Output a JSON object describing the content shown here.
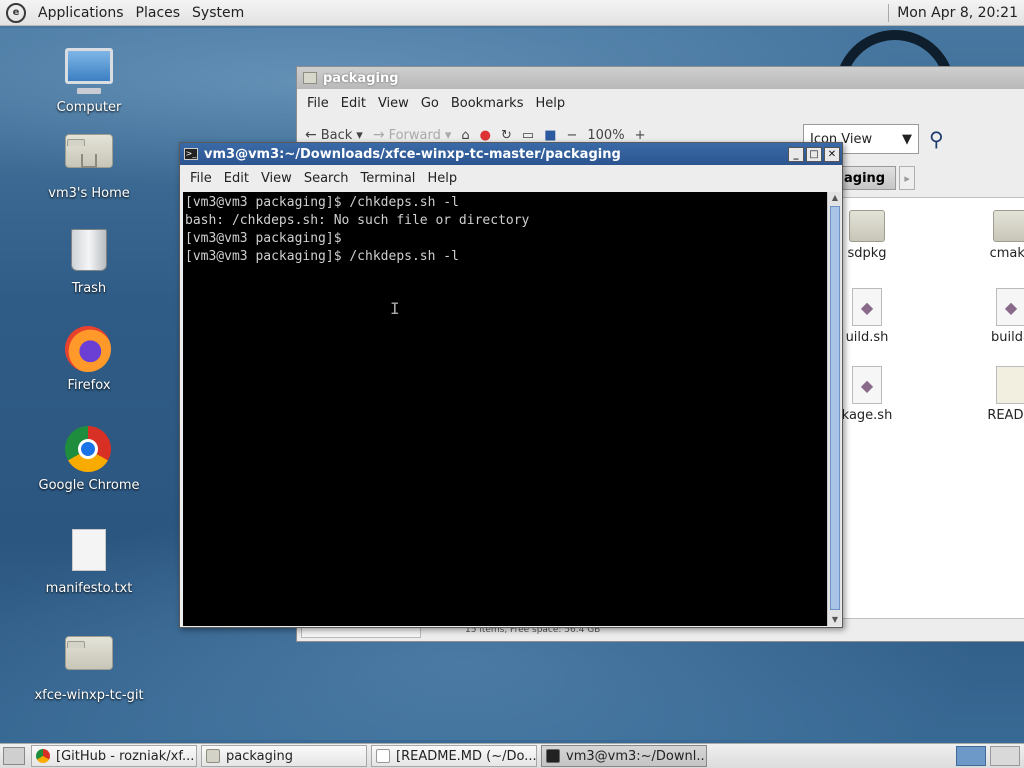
{
  "top_panel": {
    "menus": [
      "Applications",
      "Places",
      "System"
    ],
    "clock": "Mon Apr  8, 20:21"
  },
  "desktop_icons": [
    {
      "label": "Computer",
      "icon": "computer-icon"
    },
    {
      "label": "vm3's Home",
      "icon": "home-folder-icon"
    },
    {
      "label": "Trash",
      "icon": "trash-icon"
    },
    {
      "label": "Firefox",
      "icon": "firefox-icon"
    },
    {
      "label": "Google Chrome",
      "icon": "chrome-icon"
    },
    {
      "label": "manifesto.txt",
      "icon": "text-file-icon"
    },
    {
      "label": "xfce-winxp-tc-git",
      "icon": "folder-icon"
    }
  ],
  "file_manager": {
    "title": "packaging",
    "menus": [
      "File",
      "Edit",
      "View",
      "Go",
      "Bookmarks",
      "Help"
    ],
    "toolbar": {
      "back": "Back",
      "forward": "Forward",
      "zoom": "100%"
    },
    "view_select": "Icon View",
    "path_current": "aging",
    "files": [
      {
        "label": "sdpkg",
        "type": "folder"
      },
      {
        "label": "cmake",
        "type": "folder"
      },
      {
        "label": "uild.sh",
        "type": "script"
      },
      {
        "label": "builda",
        "type": "script"
      },
      {
        "label": "kage.sh",
        "type": "script"
      },
      {
        "label": "READM",
        "type": "readme"
      }
    ],
    "status": "15 items, Free space: 56.4 GB"
  },
  "terminal": {
    "title": "vm3@vm3:~/Downloads/xfce-winxp-tc-master/packaging",
    "menus": [
      "File",
      "Edit",
      "View",
      "Search",
      "Terminal",
      "Help"
    ],
    "lines": [
      "[vm3@vm3 packaging]$ /chkdeps.sh -l",
      "bash: /chkdeps.sh: No such file or directory",
      "[vm3@vm3 packaging]$",
      "[vm3@vm3 packaging]$ /chkdeps.sh -l"
    ]
  },
  "taskbar": {
    "tasks": [
      {
        "label": "[GitHub - rozniak/xf...",
        "icon": "chrome-icon",
        "active": false
      },
      {
        "label": "packaging",
        "icon": "folder-icon",
        "active": false
      },
      {
        "label": "[README.MD (~/Do...",
        "icon": "text-editor-icon",
        "active": false
      },
      {
        "label": "vm3@vm3:~/Downl...",
        "icon": "terminal-icon",
        "active": true
      }
    ]
  }
}
